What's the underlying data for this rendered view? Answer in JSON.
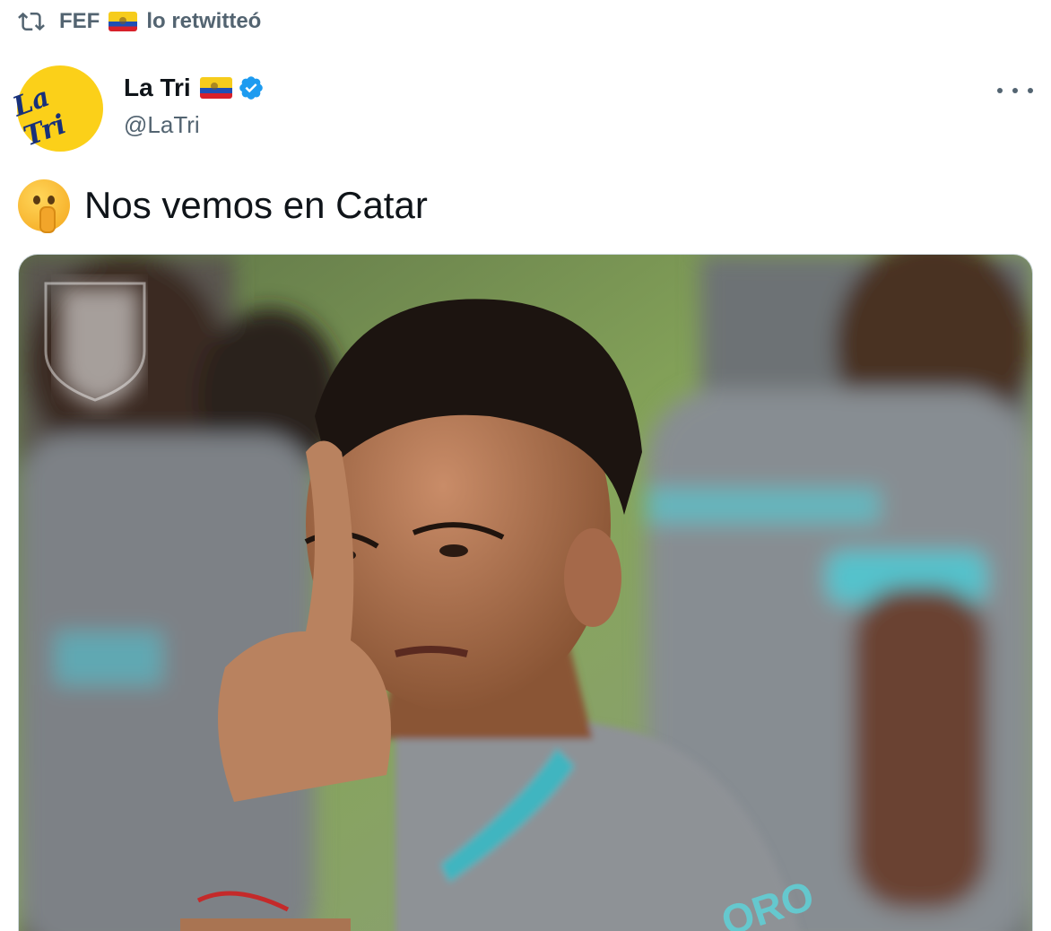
{
  "retweet": {
    "user": "FEF",
    "label": "lo retwitteó"
  },
  "author": {
    "display_name": "La Tri",
    "handle": "@LaTri",
    "verified": true,
    "avatar_text": "La Tri"
  },
  "tweet": {
    "emoji": "shushing-face",
    "text": "Nos vemos en Catar"
  },
  "icons": {
    "retweet": "retweet-icon",
    "verified": "verified-badge-icon",
    "more": "more-options-icon",
    "flag": "ecuador-flag-icon"
  },
  "colors": {
    "secondary_text": "#536471",
    "primary_text": "#0f1419",
    "verified_blue": "#1d9bf0",
    "avatar_yellow": "#fbd019"
  }
}
